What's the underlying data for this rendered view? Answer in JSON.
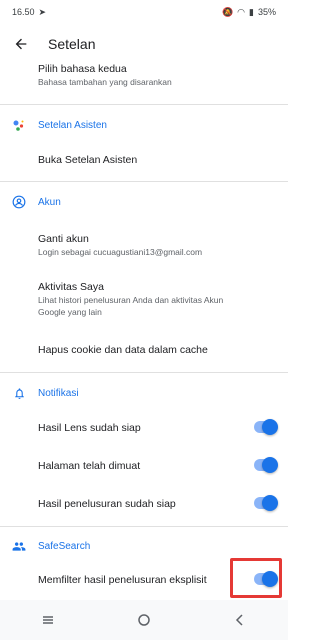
{
  "status_bar": {
    "time": "16.50",
    "battery": "35%"
  },
  "header": {
    "title": "Setelan"
  },
  "items": {
    "second_language": {
      "title": "Pilih bahasa kedua",
      "subtitle": "Bahasa tambahan yang disarankan"
    },
    "assistant_section": {
      "label": "Setelan Asisten"
    },
    "open_assistant": {
      "title": "Buka Setelan Asisten"
    },
    "account_section": {
      "label": "Akun"
    },
    "switch_account": {
      "title": "Ganti akun",
      "subtitle": "Login sebagai cucuagustiani13@gmail.com"
    },
    "my_activity": {
      "title": "Aktivitas Saya",
      "subtitle_line1": "Lihat histori penelusuran Anda dan aktivitas Akun",
      "subtitle_line2": "Google yang lain"
    },
    "clear_cookies": {
      "title": "Hapus cookie dan data dalam cache"
    },
    "notifications_section": {
      "label": "Notifikasi"
    },
    "lens_ready": {
      "label": "Hasil Lens sudah siap",
      "enabled": true
    },
    "page_loaded": {
      "label": "Halaman telah dimuat",
      "enabled": true
    },
    "search_ready": {
      "label": "Hasil penelusuran sudah siap",
      "enabled": true
    },
    "safesearch_section": {
      "label": "SafeSearch"
    },
    "filter_explicit": {
      "label": "Memfilter hasil penelusuran eksplisit",
      "enabled": true
    }
  },
  "colors": {
    "accent": "#1a73e8",
    "highlight": "#e53935"
  }
}
